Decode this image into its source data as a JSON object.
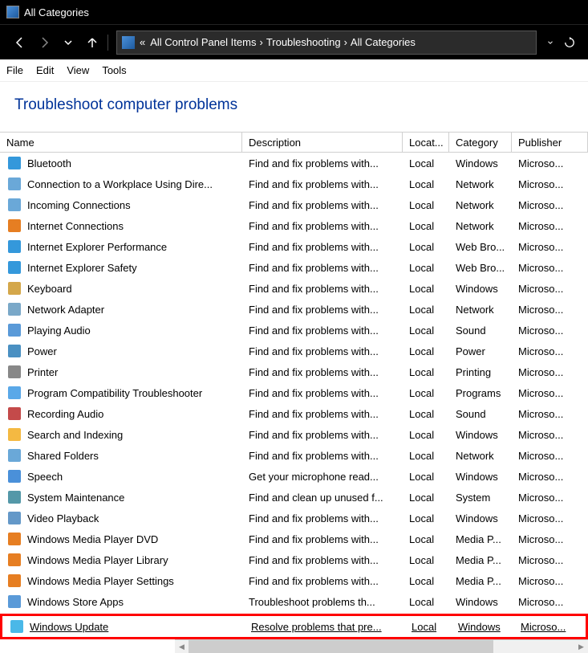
{
  "titlebar": {
    "title": "All Categories"
  },
  "navbar": {
    "breadcrumb_prefix": "«",
    "crumbs": [
      "All Control Panel Items",
      "Troubleshooting",
      "All Categories"
    ]
  },
  "menubar": [
    "File",
    "Edit",
    "View",
    "Tools"
  ],
  "heading": "Troubleshoot computer problems",
  "columns": {
    "name": "Name",
    "desc": "Description",
    "loc": "Locat...",
    "cat": "Category",
    "pub": "Publisher"
  },
  "rows": [
    {
      "name": "Bluetooth",
      "desc": "Find and fix problems with...",
      "loc": "Local",
      "cat": "Windows",
      "pub": "Microso...",
      "icon": "#3498db"
    },
    {
      "name": "Connection to a Workplace Using Dire...",
      "desc": "Find and fix problems with...",
      "loc": "Local",
      "cat": "Network",
      "pub": "Microso...",
      "icon": "#6aa8d8"
    },
    {
      "name": "Incoming Connections",
      "desc": "Find and fix problems with...",
      "loc": "Local",
      "cat": "Network",
      "pub": "Microso...",
      "icon": "#6aa8d8"
    },
    {
      "name": "Internet Connections",
      "desc": "Find and fix problems with...",
      "loc": "Local",
      "cat": "Network",
      "pub": "Microso...",
      "icon": "#e67e22"
    },
    {
      "name": "Internet Explorer Performance",
      "desc": "Find and fix problems with...",
      "loc": "Local",
      "cat": "Web Bro...",
      "pub": "Microso...",
      "icon": "#3498db"
    },
    {
      "name": "Internet Explorer Safety",
      "desc": "Find and fix problems with...",
      "loc": "Local",
      "cat": "Web Bro...",
      "pub": "Microso...",
      "icon": "#3498db"
    },
    {
      "name": "Keyboard",
      "desc": "Find and fix problems with...",
      "loc": "Local",
      "cat": "Windows",
      "pub": "Microso...",
      "icon": "#d4a74a"
    },
    {
      "name": "Network Adapter",
      "desc": "Find and fix problems with...",
      "loc": "Local",
      "cat": "Network",
      "pub": "Microso...",
      "icon": "#7aa8c8"
    },
    {
      "name": "Playing Audio",
      "desc": "Find and fix problems with...",
      "loc": "Local",
      "cat": "Sound",
      "pub": "Microso...",
      "icon": "#5a9ad8"
    },
    {
      "name": "Power",
      "desc": "Find and fix problems with...",
      "loc": "Local",
      "cat": "Power",
      "pub": "Microso...",
      "icon": "#4a90c2"
    },
    {
      "name": "Printer",
      "desc": "Find and fix problems with...",
      "loc": "Local",
      "cat": "Printing",
      "pub": "Microso...",
      "icon": "#888888"
    },
    {
      "name": "Program Compatibility Troubleshooter",
      "desc": "Find and fix problems with...",
      "loc": "Local",
      "cat": "Programs",
      "pub": "Microso...",
      "icon": "#5aa8e8"
    },
    {
      "name": "Recording Audio",
      "desc": "Find and fix problems with...",
      "loc": "Local",
      "cat": "Sound",
      "pub": "Microso...",
      "icon": "#c44a4a"
    },
    {
      "name": "Search and Indexing",
      "desc": "Find and fix problems with...",
      "loc": "Local",
      "cat": "Windows",
      "pub": "Microso...",
      "icon": "#f4b942"
    },
    {
      "name": "Shared Folders",
      "desc": "Find and fix problems with...",
      "loc": "Local",
      "cat": "Network",
      "pub": "Microso...",
      "icon": "#6aa8d8"
    },
    {
      "name": "Speech",
      "desc": "Get your microphone read...",
      "loc": "Local",
      "cat": "Windows",
      "pub": "Microso...",
      "icon": "#4a90d9"
    },
    {
      "name": "System Maintenance",
      "desc": "Find and clean up unused f...",
      "loc": "Local",
      "cat": "System",
      "pub": "Microso...",
      "icon": "#5498a8"
    },
    {
      "name": "Video Playback",
      "desc": "Find and fix problems with...",
      "loc": "Local",
      "cat": "Windows",
      "pub": "Microso...",
      "icon": "#6498c8"
    },
    {
      "name": "Windows Media Player DVD",
      "desc": "Find and fix problems with...",
      "loc": "Local",
      "cat": "Media P...",
      "pub": "Microso...",
      "icon": "#e67e22"
    },
    {
      "name": "Windows Media Player Library",
      "desc": "Find and fix problems with...",
      "loc": "Local",
      "cat": "Media P...",
      "pub": "Microso...",
      "icon": "#e67e22"
    },
    {
      "name": "Windows Media Player Settings",
      "desc": "Find and fix problems with...",
      "loc": "Local",
      "cat": "Media P...",
      "pub": "Microso...",
      "icon": "#e67e22"
    },
    {
      "name": "Windows Store Apps",
      "desc": "Troubleshoot problems th...",
      "loc": "Local",
      "cat": "Windows",
      "pub": "Microso...",
      "icon": "#5a9ad8"
    },
    {
      "name": "Windows Update",
      "desc": "Resolve problems that pre...",
      "loc": "Local",
      "cat": "Windows",
      "pub": "Microso...",
      "icon": "#4ab8e8",
      "selected": true
    }
  ]
}
